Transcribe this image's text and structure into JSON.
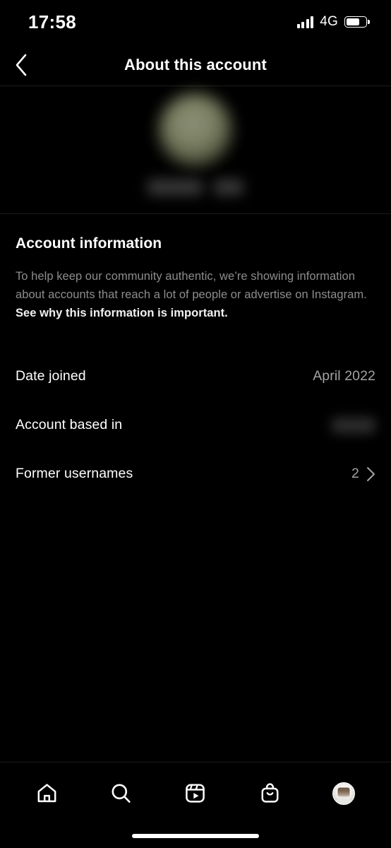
{
  "status_bar": {
    "time": "17:58",
    "network_label": "4G",
    "signal_icon": "signal-bars-icon",
    "battery_icon": "battery-icon",
    "battery_level_percent": 68
  },
  "header": {
    "back_icon": "chevron-left-icon",
    "title": "About this account"
  },
  "profile": {
    "avatar_state": "blurred",
    "username_state": "blurred"
  },
  "account_information": {
    "title": "Account information",
    "description_prefix": "To help keep our community authentic, we’re showing information about accounts that reach a lot of people or advertise on Instagram. ",
    "description_link": "See why this information is important.",
    "rows": [
      {
        "label": "Date joined",
        "value": "April 2022",
        "value_state": "text",
        "chevron": false
      },
      {
        "label": "Account based in",
        "value": "",
        "value_state": "blurred",
        "chevron": false
      },
      {
        "label": "Former usernames",
        "value": "2",
        "value_state": "text",
        "chevron": true
      }
    ]
  },
  "tab_bar": {
    "items": [
      {
        "name": "home",
        "icon": "home-icon"
      },
      {
        "name": "search",
        "icon": "search-icon"
      },
      {
        "name": "reels",
        "icon": "reels-icon"
      },
      {
        "name": "shop",
        "icon": "shopping-bag-icon"
      },
      {
        "name": "profile",
        "icon": "profile-avatar-icon"
      }
    ]
  },
  "home_indicator": {
    "visible": true
  },
  "colors": {
    "background": "#000000",
    "primary_text": "#ffffff",
    "secondary_text": "#8d8d8d",
    "value_text": "#a3a3a3",
    "divider": "#1b1b1b"
  }
}
